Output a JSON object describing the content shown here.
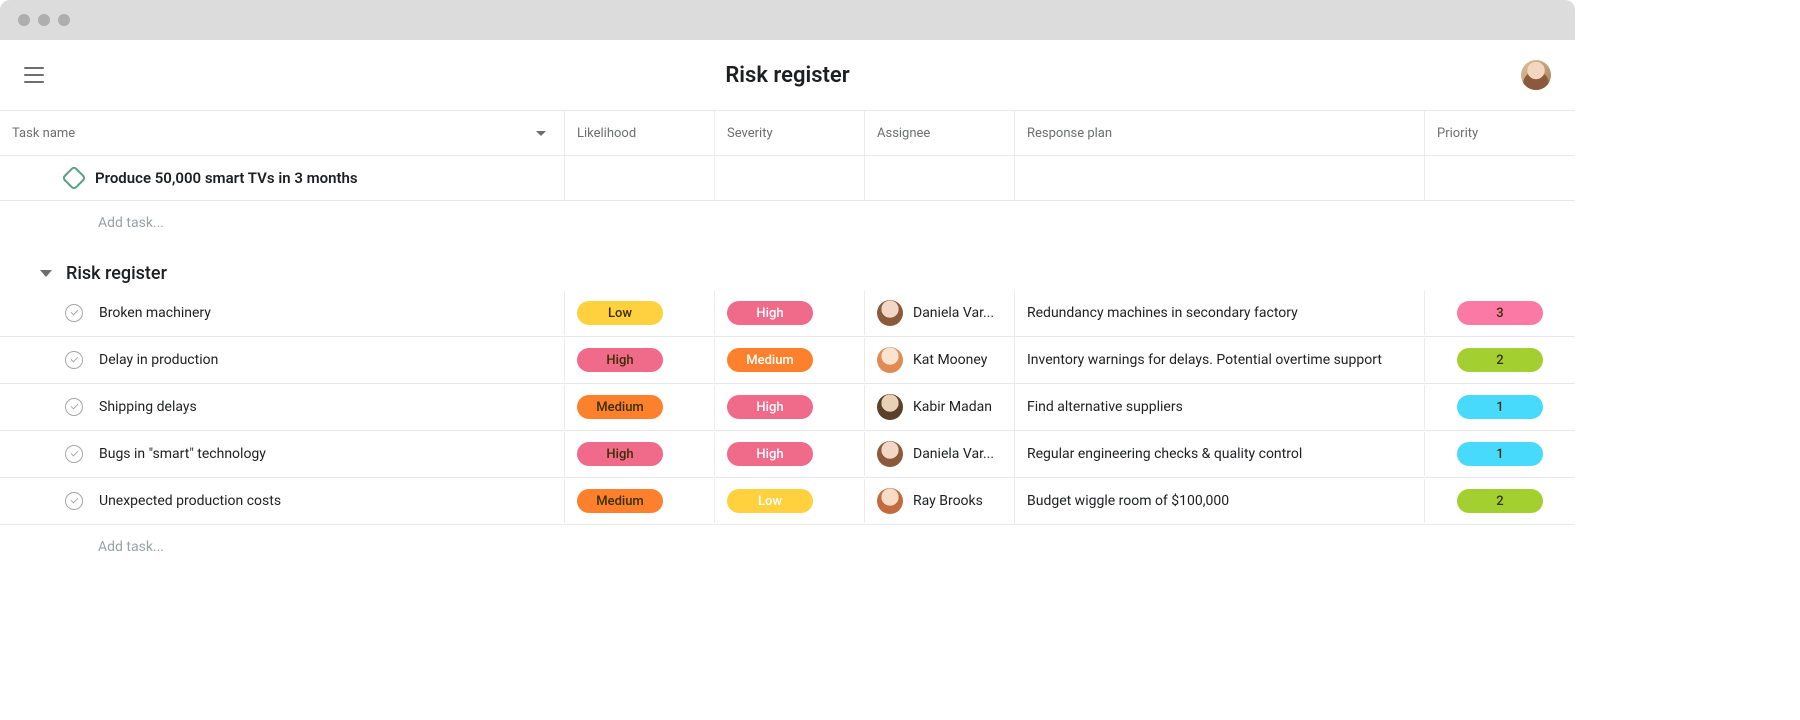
{
  "page_title": "Risk register",
  "columns": {
    "task": "Task name",
    "likelihood": "Likelihood",
    "severity": "Severity",
    "assignee": "Assignee",
    "response": "Response plan",
    "priority": "Priority"
  },
  "goal": {
    "title": "Produce 50,000 smart TVs in 3 months"
  },
  "add_task_label": "Add task...",
  "section": {
    "title": "Risk register"
  },
  "pill_colors": {
    "Low_yellow": "#ffd13e",
    "High_pink": "#f06a8a",
    "Medium_orange": "#fd812d",
    "p_pink": "#fb7aa5",
    "p_green": "#a4cf30",
    "p_blue": "#48dafd"
  },
  "tasks": [
    {
      "name": "Broken machinery",
      "likelihood": "Low",
      "likelihood_color": "#ffd13e",
      "severity": "High",
      "severity_color": "#f06a8a",
      "assignee": "Daniela Var...",
      "avatar_class": "av-a",
      "response": "Redundancy machines in secondary factory",
      "priority": "3",
      "priority_color": "#fb7aa5"
    },
    {
      "name": "Delay in production",
      "likelihood": "High",
      "likelihood_color": "#f06a8a",
      "severity": "Medium",
      "severity_color": "#fd812d",
      "assignee": "Kat Mooney",
      "avatar_class": "av-b",
      "response": "Inventory warnings for delays. Potential overtime support",
      "priority": "2",
      "priority_color": "#a4cf30"
    },
    {
      "name": "Shipping delays",
      "likelihood": "Medium",
      "likelihood_color": "#fd812d",
      "severity": "High",
      "severity_color": "#f06a8a",
      "assignee": "Kabir Madan",
      "avatar_class": "av-c",
      "response": "Find alternative suppliers",
      "priority": "1",
      "priority_color": "#48dafd"
    },
    {
      "name": "Bugs in \"smart\" technology",
      "likelihood": "High",
      "likelihood_color": "#f06a8a",
      "severity": "High",
      "severity_color": "#f06a8a",
      "assignee": "Daniela Var...",
      "avatar_class": "av-a",
      "response": "Regular engineering checks & quality control",
      "priority": "1",
      "priority_color": "#48dafd"
    },
    {
      "name": "Unexpected production costs",
      "likelihood": "Medium",
      "likelihood_color": "#fd812d",
      "severity": "Low",
      "severity_color": "#ffd13e",
      "assignee": "Ray Brooks",
      "avatar_class": "av-d",
      "response": "Budget wiggle room of $100,000",
      "priority": "2",
      "priority_color": "#a4cf30"
    }
  ]
}
